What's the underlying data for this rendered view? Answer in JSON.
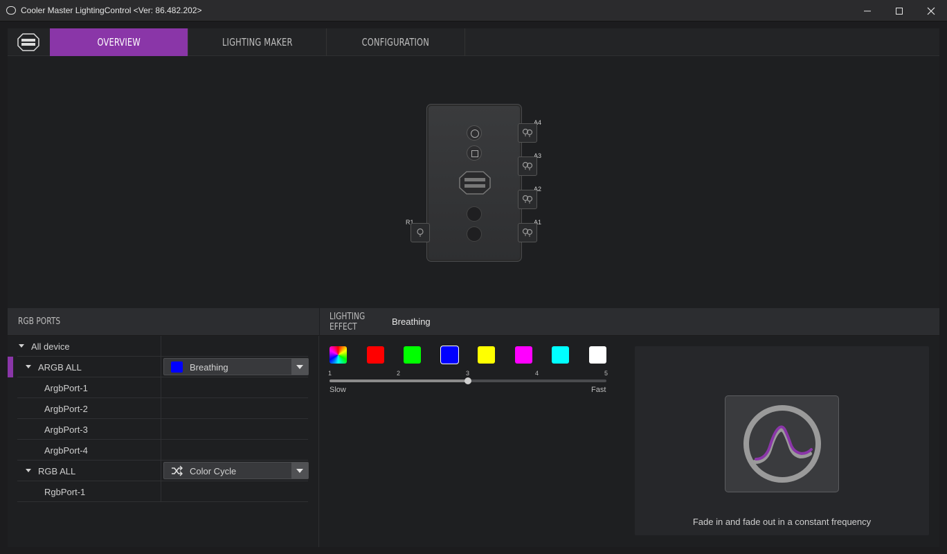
{
  "window": {
    "title": "Cooler Master LightingControl <Ver: 86.482.202>",
    "controls": [
      "minimize-icon",
      "maximize-icon",
      "close-icon"
    ]
  },
  "tabs": [
    {
      "label": "OVERVIEW",
      "active": true
    },
    {
      "label": "LIGHTING MAKER",
      "active": false
    },
    {
      "label": "CONFIGURATION",
      "active": false
    }
  ],
  "device": {
    "ports": {
      "a4": "A4",
      "a3": "A3",
      "a2": "A2",
      "a1": "A1",
      "r1": "R1"
    }
  },
  "rgb_ports": {
    "title": "RGB PORTS",
    "all_device": "All device",
    "argb_all": {
      "label": "ARGB ALL",
      "effect": "Breathing",
      "swatch_color": "#0000ff"
    },
    "argb_ports": [
      "ArgbPort-1",
      "ArgbPort-2",
      "ArgbPort-3",
      "ArgbPort-4"
    ],
    "rgb_all": {
      "label": "RGB ALL",
      "effect": "Color Cycle",
      "icon": "shuffle-icon"
    },
    "rgb_ports": [
      "RgbPort-1"
    ]
  },
  "lighting_effect": {
    "title": "LIGHTING EFFECT",
    "value": "Breathing",
    "colors": [
      "rainbow",
      "#ff0000",
      "#00ff00",
      "#0000ff",
      "#ffff00",
      "#ff00ff",
      "#00ffff",
      "#ffffff"
    ],
    "selected_color": "#0000ff",
    "speed": {
      "ticks": [
        "1",
        "2",
        "3",
        "4",
        "5"
      ],
      "value": 3,
      "min_label": "Slow",
      "max_label": "Fast"
    },
    "description": "Fade in and fade out in a constant frequency",
    "accent": "#8a36a8"
  }
}
